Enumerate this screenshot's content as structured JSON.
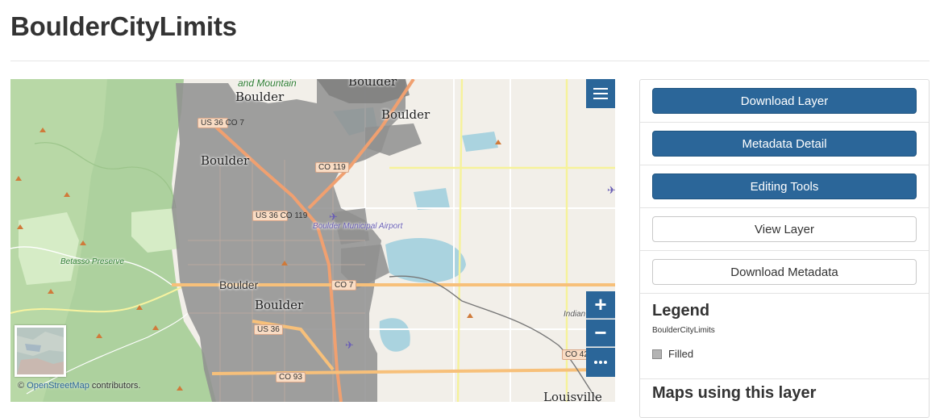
{
  "page": {
    "title": "BoulderCityLimits"
  },
  "map": {
    "labels": {
      "boulder_top": "Boulder",
      "boulder_upper_left": "Boulder",
      "boulder_upper_right": "Boulder",
      "boulder_mid_left": "Boulder",
      "boulder_center": "Boulder",
      "boulder_center_serif": "Boulder",
      "park_top": "and Mountain",
      "betasso": "Betasso Preserve",
      "airport": "Boulder Municipal Airport",
      "indian_peaks": "Indian Peaks",
      "louisville": "Louisville"
    },
    "shields": {
      "us36_co7": "US 36 CO 7",
      "co119_top": "CO 119",
      "us36_co119": "US 36 CO 119",
      "co7": "CO 7",
      "us36_bottom": "US 36",
      "co93": "CO 93",
      "co42": "CO 42"
    },
    "controls": {
      "layers_icon": "hamburger-icon",
      "zoom_in": "+",
      "zoom_out": "−",
      "more": "•••"
    },
    "attribution": {
      "prefix": "©",
      "link": "OpenStreetMap",
      "suffix": "contributors."
    },
    "colors": {
      "city_fill": "#8f8f8f",
      "park_green": "#add19e",
      "road_orange": "#f7c07a",
      "water": "#aad3df",
      "control_blue": "#2b6699"
    }
  },
  "sidebar": {
    "buttons": {
      "download_layer": "Download Layer",
      "metadata_detail": "Metadata Detail",
      "editing_tools": "Editing Tools",
      "view_layer": "View Layer",
      "download_metadata": "Download Metadata"
    },
    "legend": {
      "heading": "Legend",
      "layer_name": "BoulderCityLimits",
      "entry_label": "Filled"
    },
    "maps_using_heading": "Maps using this layer"
  }
}
